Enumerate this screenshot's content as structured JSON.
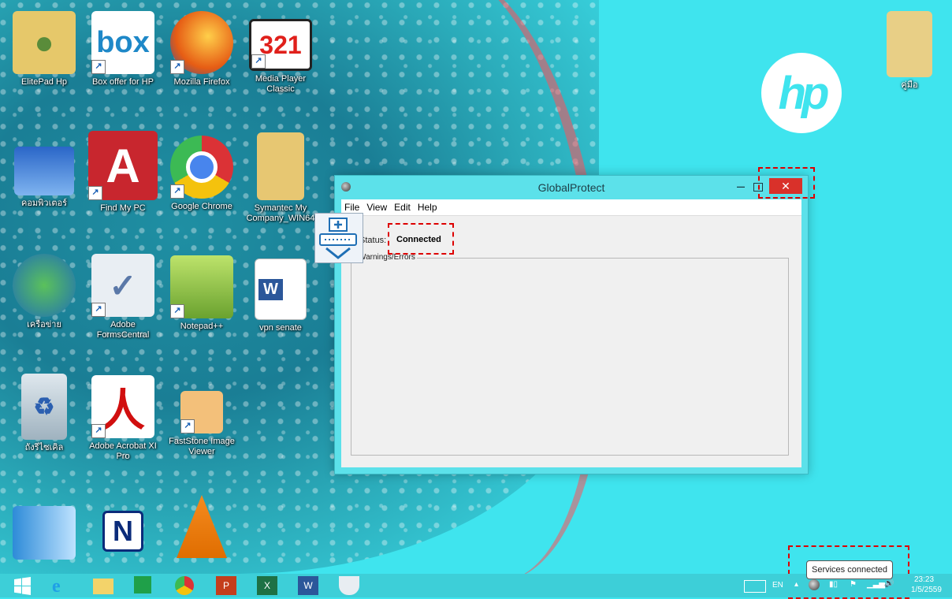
{
  "desktop": {
    "icons": [
      {
        "label": "ElitePad Hp"
      },
      {
        "label": "Box offer for HP"
      },
      {
        "label": "Mozilla Firefox"
      },
      {
        "label": "Media Player Classic"
      },
      {
        "label": "คอมพิวเตอร์"
      },
      {
        "label": "Find My PC"
      },
      {
        "label": "Google Chrome"
      },
      {
        "label": "Symantec My Company_WIN64"
      },
      {
        "label": "เครือข่าย"
      },
      {
        "label": "Adobe FormsCentral"
      },
      {
        "label": "Notepad++"
      },
      {
        "label": "vpn senate"
      },
      {
        "label": "ถังรีไซเคิล"
      },
      {
        "label": "Adobe Acrobat XI Pro"
      },
      {
        "label": "FastStone Image Viewer"
      },
      {
        "label": ""
      },
      {
        "label": ""
      },
      {
        "label": ""
      },
      {
        "label": "คู่มือ"
      }
    ],
    "hp_logo_text": "hp"
  },
  "window": {
    "title": "GlobalProtect",
    "close_glyph": "✕",
    "minimize_glyph": "–",
    "menu": [
      "File",
      "View",
      "Edit",
      "Help"
    ],
    "status_label": "Status:",
    "status_value": "Connected",
    "group_label": "Warnings/Errors"
  },
  "tray": {
    "tooltip": "Services connected",
    "language": "EN",
    "time": "23:23",
    "date": "1/5/2559"
  },
  "colors": {
    "accent": "#3fe4ee",
    "highlight": "#dd0000",
    "close_button": "#d9312a"
  }
}
